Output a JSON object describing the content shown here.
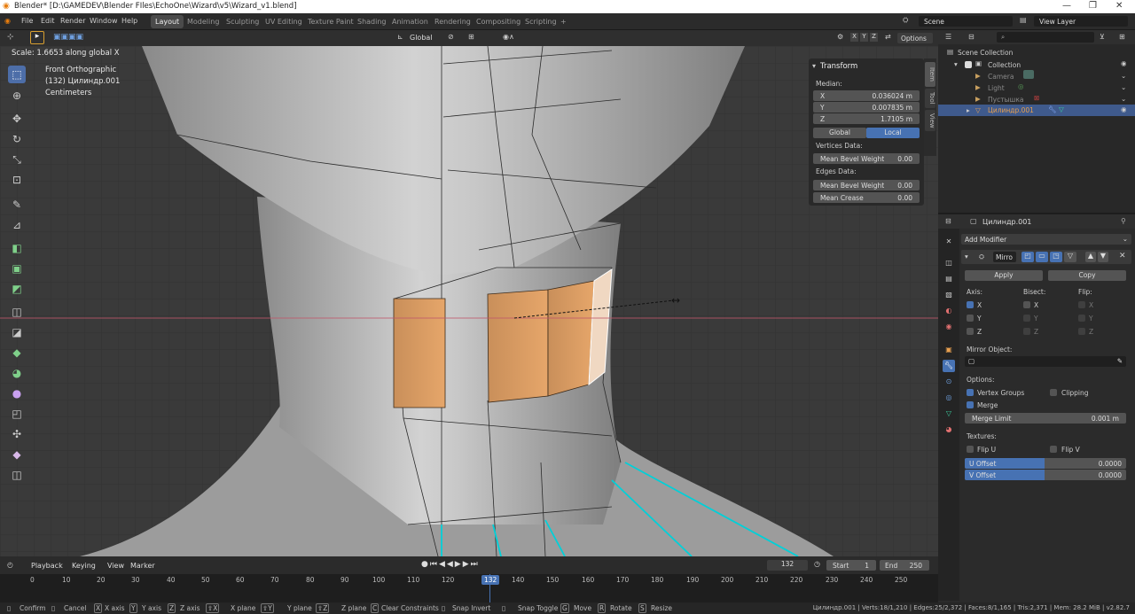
{
  "window": {
    "title": "Blender* [D:\\GAMEDEV\\Blender FIles\\EchoOne\\Wizard\\v5\\Wizard_v1.blend]"
  },
  "menu": [
    "File",
    "Edit",
    "Render",
    "Window",
    "Help"
  ],
  "workspaces": [
    "Layout",
    "Modeling",
    "Sculpting",
    "UV Editing",
    "Texture Paint",
    "Shading",
    "Animation",
    "Rendering",
    "Compositing",
    "Scripting"
  ],
  "scene": {
    "name": "Scene",
    "view_layer": "View Layer"
  },
  "header": {
    "orientation": "Global",
    "options": "Options",
    "axes": [
      "X",
      "Y",
      "Z"
    ]
  },
  "viewport": {
    "operator_text": "Scale: 1.6653 along global X",
    "view_name": "Front Orthographic",
    "object_info": "(132) Цилиндр.001",
    "units": "Centimeters"
  },
  "transform_panel": {
    "title": "Transform",
    "median_label": "Median:",
    "x_label": "X",
    "x": "0.036024 m",
    "y_label": "Y",
    "y": "0.007835 m",
    "z_label": "Z",
    "z": "1.7105 m",
    "global": "Global",
    "local": "Local",
    "vertices_data": "Vertices Data:",
    "mean_bevel_weight_label": "Mean Bevel Weight",
    "mean_bevel_weight_v": "0.00",
    "edges_data": "Edges Data:",
    "mean_bevel_weight2_label": "Mean Bevel Weight",
    "mean_bevel_weight2_v": "0.00",
    "mean_crease_label": "Mean Crease",
    "mean_crease_v": "0.00"
  },
  "viewport_tabs": [
    "Item",
    "Tool",
    "View"
  ],
  "outliner": {
    "scene_collection": "Scene Collection",
    "collection": "Collection",
    "items": [
      "Camera",
      "Light",
      "Пустышка",
      "Цилиндр.001"
    ]
  },
  "properties": {
    "object_name": "Цилиндр.001",
    "add_modifier": "Add Modifier",
    "modifier_name": "Mirro",
    "apply": "Apply",
    "copy": "Copy",
    "axis_label": "Axis:",
    "bisect_label": "Bisect:",
    "flip_label": "Flip:",
    "x": "X",
    "y": "Y",
    "z": "Z",
    "mirror_object": "Mirror Object:",
    "options": "Options:",
    "vertex_groups": "Vertex Groups",
    "clipping": "Clipping",
    "merge": "Merge",
    "merge_limit_label": "Merge Limit",
    "merge_limit": "0.001 m",
    "textures": "Textures:",
    "flip_u": "Flip U",
    "flip_v": "Flip V",
    "u_offset_label": "U Offset",
    "u_offset": "0.0000",
    "v_offset_label": "V Offset",
    "v_offset": "0.0000"
  },
  "timeline": {
    "playback": "Playback",
    "keying": "Keying",
    "view": "View",
    "marker": "Marker",
    "current_frame": "132",
    "start_label": "Start",
    "start": "1",
    "end_label": "End",
    "end": "250",
    "ticks": [
      "0",
      "10",
      "20",
      "30",
      "40",
      "50",
      "60",
      "70",
      "80",
      "90",
      "100",
      "110",
      "120",
      "132",
      "140",
      "150",
      "160",
      "170",
      "180",
      "190",
      "200",
      "210",
      "220",
      "230",
      "240",
      "250"
    ]
  },
  "statusbar": {
    "items": [
      "Confirm",
      "Cancel",
      "X axis",
      "Y axis",
      "Z axis",
      "X plane",
      "Y plane",
      "Z plane",
      "Clear Constraints",
      "Snap Invert",
      "Snap Toggle",
      "Move",
      "Rotate",
      "Resize"
    ],
    "keys": [
      "X",
      "Y",
      "Z",
      "⇧X",
      "⇧Y",
      "⇧Z",
      "C",
      "G",
      "R",
      "S"
    ],
    "stats": "Цилиндр.001 | Verts:18/1,210 | Edges:25/2,372 | Faces:8/1,165 | Tris:2,371 | Mem: 28.2 MiB | v2.82.7"
  },
  "colors": {
    "accent": "#4772b3",
    "selected_face": "#d99a5e",
    "seam": "#00d0d8"
  }
}
